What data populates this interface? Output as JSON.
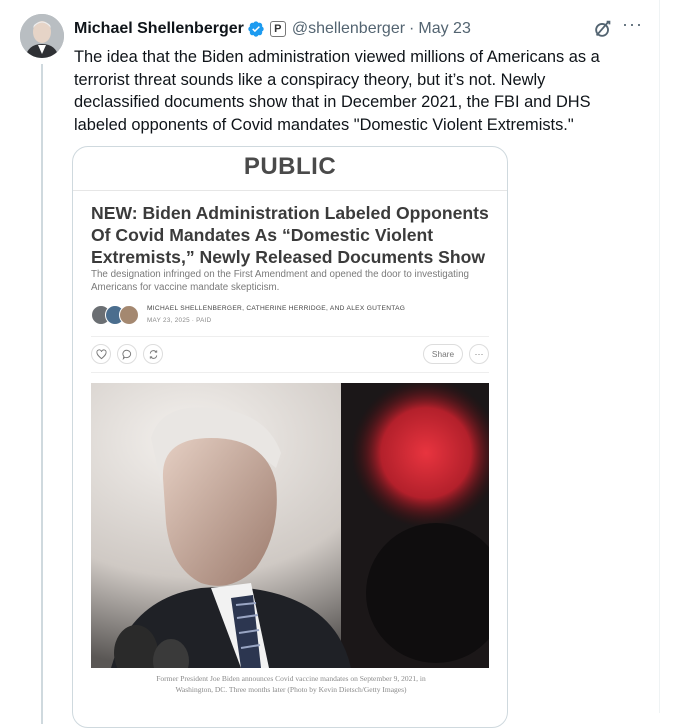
{
  "author": {
    "name": "Michael Shellenberger",
    "affiliate_badge": "P",
    "handle": "@shellenberger",
    "separator": "·",
    "date": "May 23"
  },
  "actions": {
    "more_label": "···"
  },
  "tweet": {
    "text": "The idea that the Biden administration viewed millions of Americans as a terrorist threat sounds like a conspiracy theory, but it’s not. Newly declassified documents show that in December 2021, the FBI and DHS labeled opponents of Covid mandates \"Domestic Violent Extremists.\""
  },
  "card": {
    "logo": "PUBLIC",
    "headline": "NEW: Biden Administration Labeled Opponents Of Covid Mandates As “Domestic Violent Extremists,” Newly Released Documents Show",
    "subtitle": "The designation infringed on the First Amendment and opened the door to investigating Americans for vaccine mandate skepticism.",
    "authors": "MICHAEL SHELLENBERGER, CATHERINE HERRIDGE, AND ALEX GUTENTAG",
    "pubdate": "MAY 23, 2025 ∙ PAID",
    "share_label": "Share",
    "more_label": "···",
    "caption": "Former President Joe Biden announces Covid vaccine mandates on September 9, 2021, in Washington, DC. Three months later (Photo by Kevin Dietsch/Getty Images)"
  },
  "colors": {
    "verified": "#1d9bf0",
    "text_primary": "#0f1419",
    "text_secondary": "#536471",
    "border": "#cfd9de"
  },
  "icons": [
    "verified-badge-icon",
    "grok-icon",
    "heart-icon",
    "comment-icon",
    "restack-icon"
  ]
}
